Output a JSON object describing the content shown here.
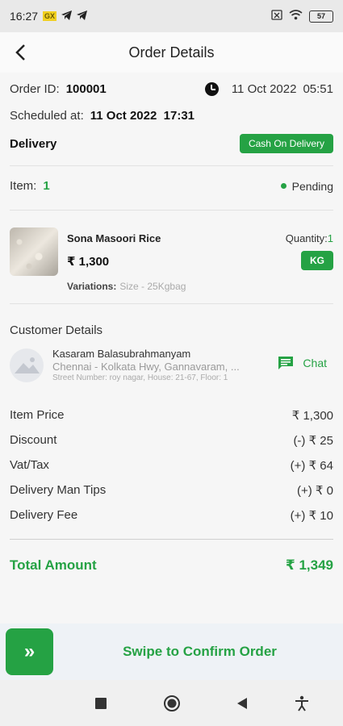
{
  "status_bar": {
    "time": "16:27",
    "badge": "GX",
    "battery": "57"
  },
  "app_bar": {
    "title": "Order Details"
  },
  "order": {
    "id_label": "Order ID:",
    "id_value": "100001",
    "date": "11 Oct 2022",
    "time": "05:51",
    "scheduled_label": "Scheduled at:",
    "scheduled_value": "11 Oct 2022  17:31",
    "type": "Delivery",
    "payment_badge": "Cash On Delivery",
    "item_label": "Item:",
    "item_count": "1",
    "status": "Pending"
  },
  "product": {
    "name": "Sona Masoori Rice",
    "price": "₹ 1,300",
    "quantity_label": "Quantity:",
    "quantity_value": "1",
    "unit": "KG",
    "variations_label": "Variations:",
    "variations_value": "Size - 25Kgbag"
  },
  "customer": {
    "section_title": "Customer Details",
    "name": "Kasaram Balasubrahmanyam",
    "address": "Chennai - Kolkata Hwy, Gannavaram, ...",
    "street": "Street Number: roy nagar, House: 21-67, Floor: 1",
    "chat_label": "Chat"
  },
  "summary": {
    "rows": [
      {
        "label": "Item Price",
        "value": "₹ 1,300"
      },
      {
        "label": "Discount",
        "value": "(-) ₹ 25"
      },
      {
        "label": "Vat/Tax",
        "value": "(+) ₹ 64"
      },
      {
        "label": "Delivery Man Tips",
        "value": "(+) ₹ 0"
      },
      {
        "label": "Delivery Fee",
        "value": "(+) ₹ 10"
      }
    ],
    "total_label": "Total Amount",
    "total_value": "₹ 1,349"
  },
  "swipe": {
    "label": "Swipe to Confirm Order",
    "handle_glyph": "»"
  },
  "colors": {
    "accent": "#25a244"
  }
}
